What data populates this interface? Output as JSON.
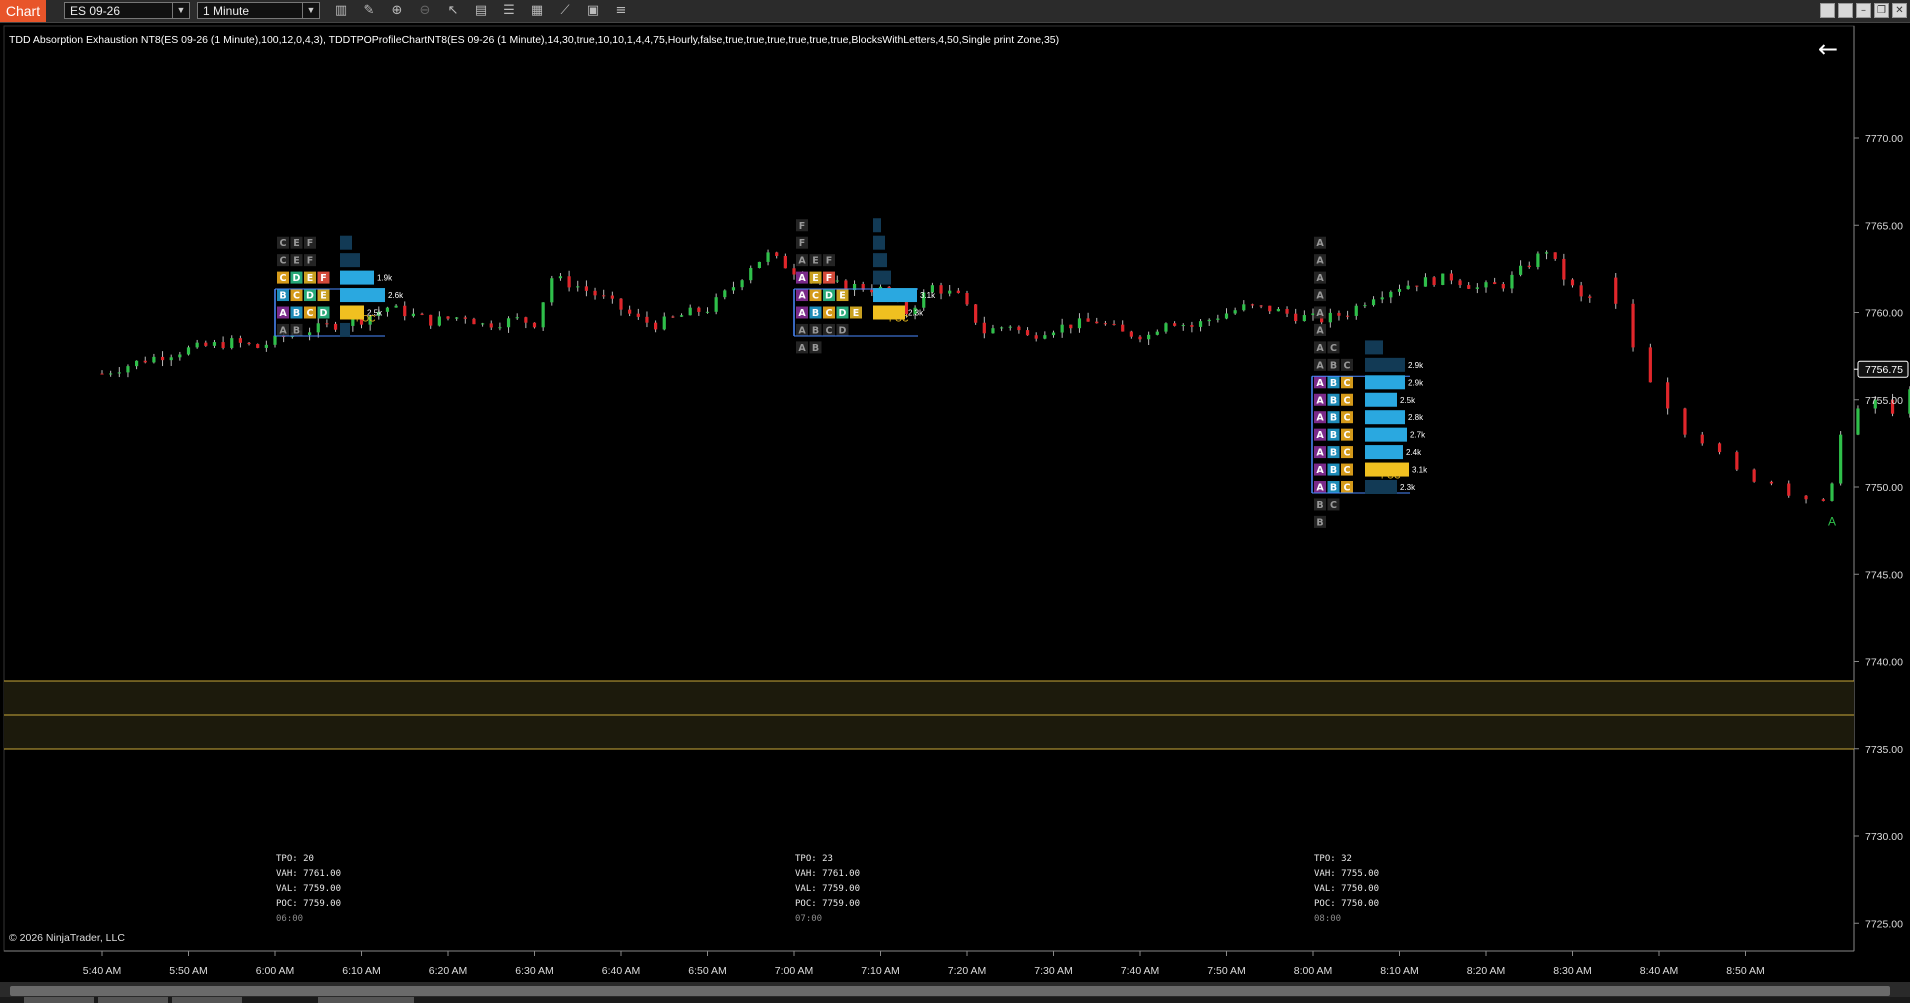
{
  "toolbar": {
    "chart_tab": "Chart",
    "instrument": "ES 09-26",
    "interval": "1 Minute"
  },
  "chart": {
    "indicator_label": "TDD Absorption Exhaustion NT8(ES 09-26 (1 Minute),100,12,0,4,3), TDDTPOProfileChartNT8(ES 09-26 (1 Minute),14,30,true,10,10,1,4,4,75,Hourly,false,true,true,true,true,true,true,BlocksWithLetters,4,50,Single print Zone,35)",
    "copyright": "© 2026 NinjaTrader, LLC",
    "last_price": "7756.75",
    "price_labels": [
      "7770.00",
      "7765.00",
      "7760.00",
      "7755.00",
      "7750.00",
      "7745.00",
      "7740.00",
      "7735.00",
      "7730.00",
      "7725.00"
    ],
    "time_labels": [
      "5:40 AM",
      "5:50 AM",
      "6:00 AM",
      "6:10 AM",
      "6:20 AM",
      "6:30 AM",
      "6:40 AM",
      "6:50 AM",
      "7:00 AM",
      "7:10 AM",
      "7:20 AM",
      "7:30 AM",
      "7:40 AM",
      "7:50 AM",
      "8:00 AM",
      "8:10 AM",
      "8:20 AM",
      "8:30 AM",
      "8:40 AM",
      "8:50 AM"
    ],
    "signal_marker": "A",
    "poc_tag": "POC",
    "vah_tag": "VAH",
    "val_tag": "VAL"
  },
  "profiles": [
    {
      "stats": {
        "tpo": "TPO: 20",
        "vah": "VAH: 7761.00",
        "val": "VAL: 7759.00",
        "poc": "POC: 7759.00",
        "time": "06:00"
      },
      "volumes": [
        "1.9k",
        "2.6k",
        "2.5k"
      ]
    },
    {
      "stats": {
        "tpo": "TPO: 23",
        "vah": "VAH: 7761.00",
        "val": "VAL: 7759.00",
        "poc": "POC: 7759.00",
        "time": "07:00"
      },
      "volumes": [
        "3.1k",
        "2.3k"
      ]
    },
    {
      "stats": {
        "tpo": "TPO: 32",
        "vah": "VAH: 7755.00",
        "val": "VAL: 7750.00",
        "poc": "POC: 7750.00",
        "time": "08:00"
      },
      "volumes": [
        "2.9k",
        "2.9k",
        "2.5k",
        "2.8k",
        "2.7k",
        "2.4k",
        "3.1k",
        "2.3k"
      ]
    }
  ],
  "colors": {
    "up": "#2fbf4a",
    "down": "#e0262b",
    "accent": "#e8552a",
    "single_print_zone": "#c8a83a",
    "volume_bar": "#2aa8e0",
    "poc_bar": "#f0c020"
  }
}
